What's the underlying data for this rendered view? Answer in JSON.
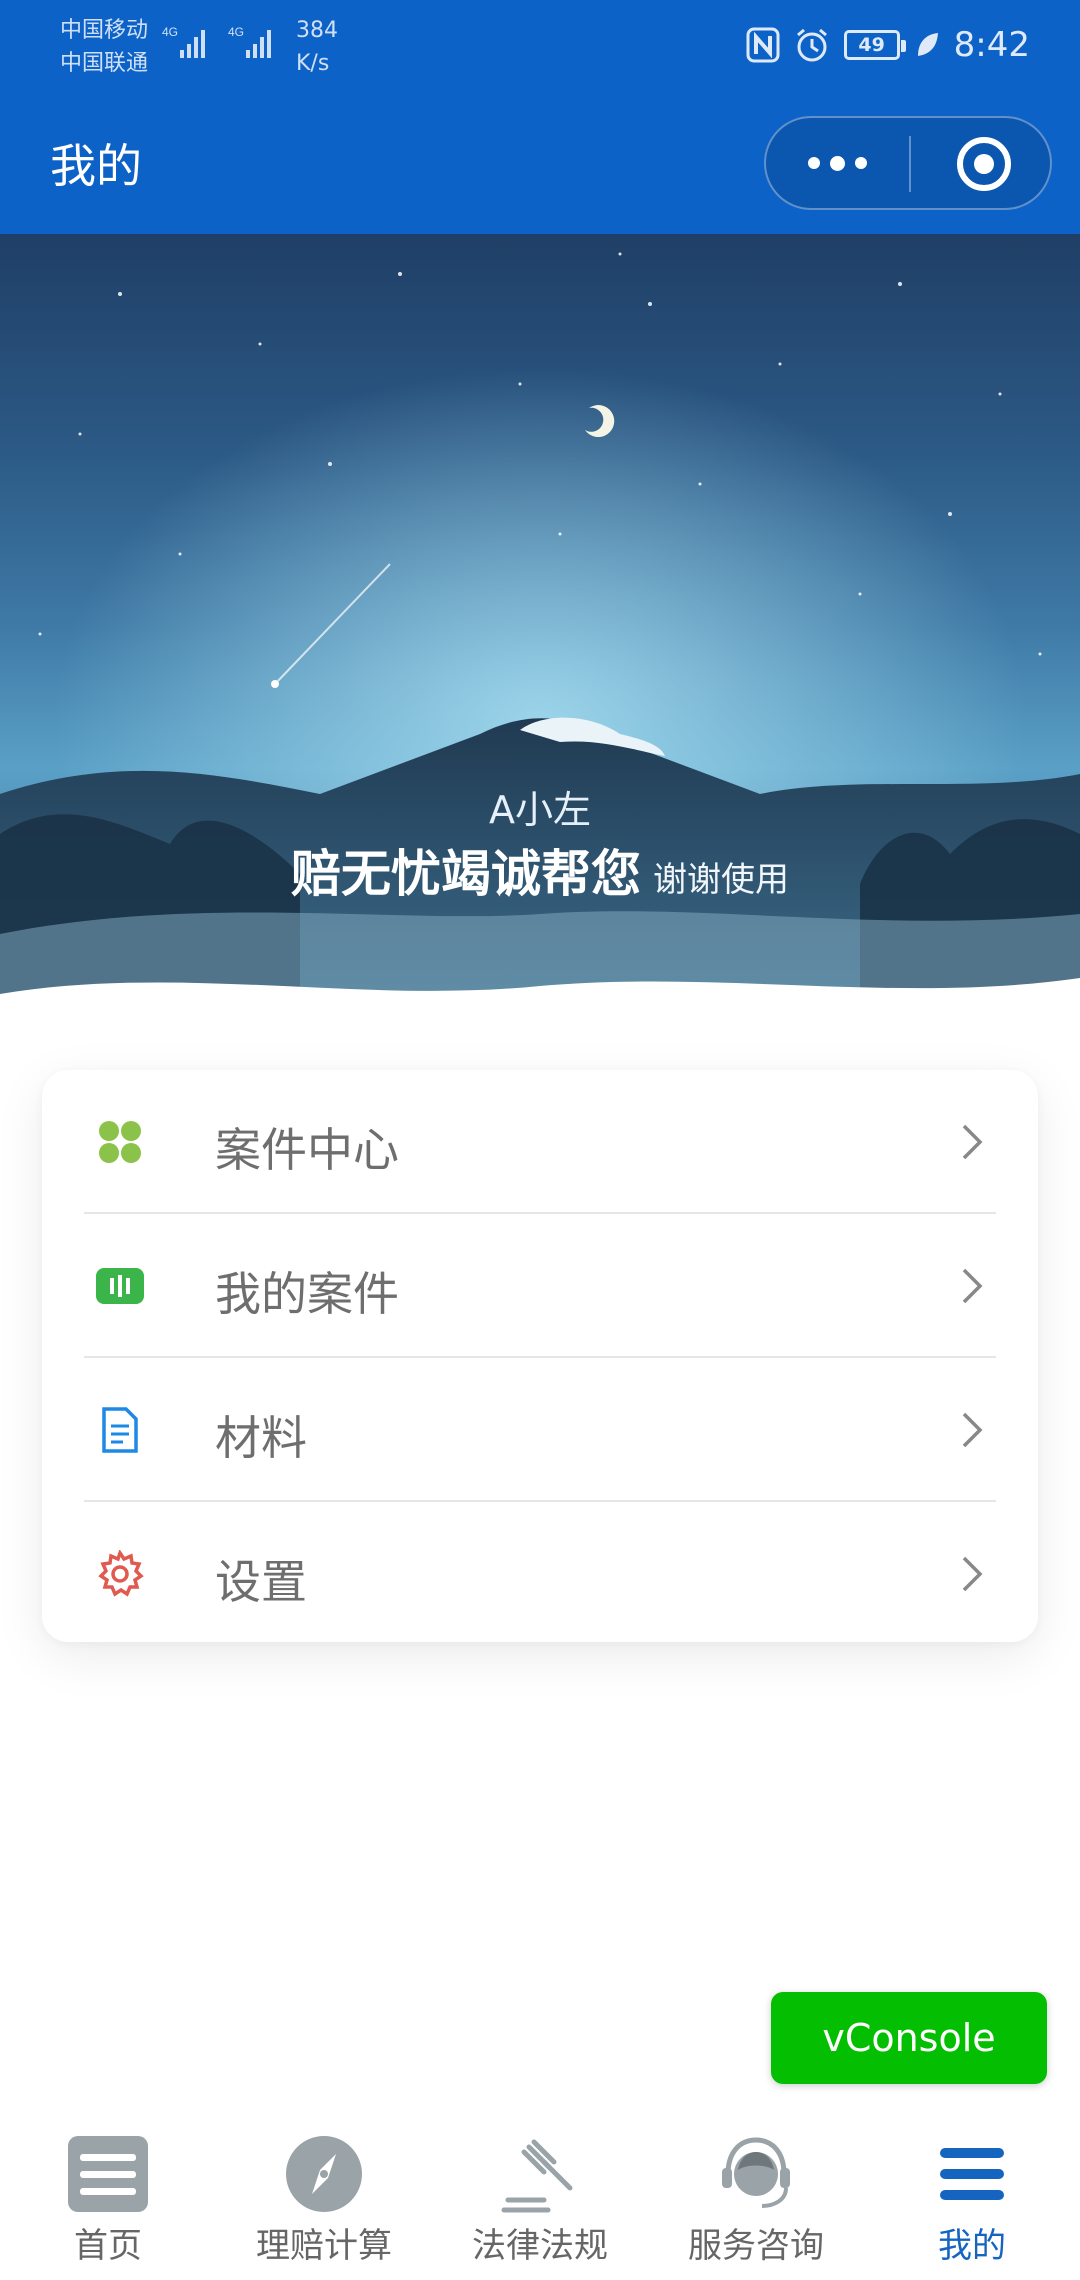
{
  "status_bar": {
    "carrier_1": "中国移动",
    "carrier_2": "中国联通",
    "net_1": "4G",
    "net_2": "4G",
    "speed_value": "384",
    "speed_unit": "K/s",
    "battery": "49",
    "time": "8:42",
    "icons": [
      "signal-icon",
      "nfc-icon",
      "alarm-icon",
      "battery-icon",
      "leaf-icon"
    ]
  },
  "navbar": {
    "title": "我的",
    "more_icon": "more-dots-icon",
    "close_icon": "target-circle-icon"
  },
  "hero": {
    "user_name": "A小左",
    "slogan": "赔无忧竭诚帮您",
    "slogan_sub": "谢谢使用"
  },
  "menu": {
    "items": [
      {
        "label": "案件中心",
        "icon": "grid-four-leaf-icon",
        "color": "#8bc34a"
      },
      {
        "label": "我的案件",
        "icon": "audio-bars-icon",
        "color": "#3bb54a"
      },
      {
        "label": "材料",
        "icon": "document-icon",
        "color": "#1e88e5"
      },
      {
        "label": "设置",
        "icon": "gear-icon",
        "color": "#e05a4f"
      }
    ],
    "arrow_icon": "chevron-right-icon"
  },
  "vconsole": {
    "label": "vConsole",
    "color": "#04be02"
  },
  "tabbar": {
    "active_color": "#1565c0",
    "tabs": [
      {
        "label": "首页",
        "icon": "home-list-icon"
      },
      {
        "label": "理赔计算",
        "icon": "compass-icon"
      },
      {
        "label": "法律法规",
        "icon": "gavel-icon"
      },
      {
        "label": "服务咨询",
        "icon": "headset-agent-icon"
      },
      {
        "label": "我的",
        "icon": "menu-lines-icon",
        "active": true
      }
    ]
  },
  "colors": {
    "brand_blue": "#0d62c8",
    "menu_text": "#6e6e6e"
  }
}
